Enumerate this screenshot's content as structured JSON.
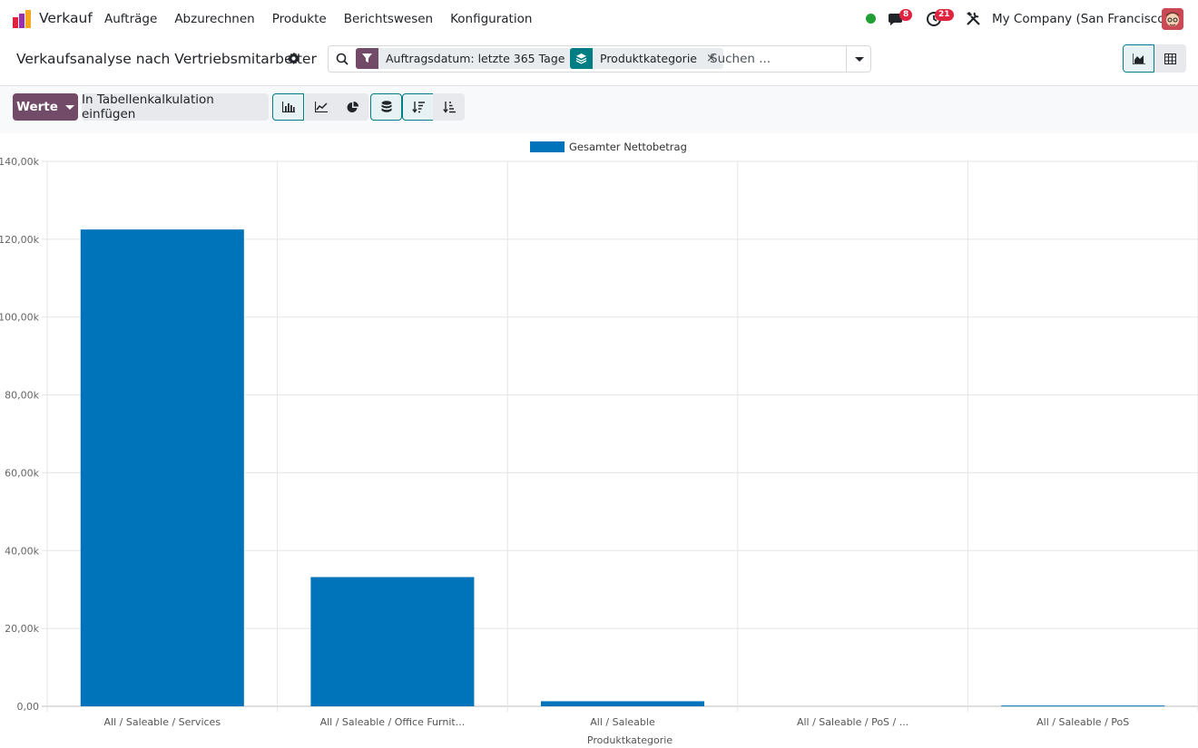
{
  "navbar": {
    "app_name": "Verkauf",
    "menu": [
      "Aufträge",
      "Abzurechnen",
      "Produkte",
      "Berichtswesen",
      "Konfiguration"
    ],
    "messages_count": "8",
    "activities_count": "21",
    "company": "My Company (San Francisco)"
  },
  "control_panel": {
    "title": "Verkaufsanalyse nach Vertriebsmitarbeiter",
    "facets": [
      {
        "type": "filter",
        "label": "Auftragsdatum: letzte 365 Tage",
        "icon": "filter-icon"
      },
      {
        "type": "groupby",
        "label": "Produktkategorie",
        "icon": "layers-icon"
      }
    ],
    "search_placeholder": "Suchen ..."
  },
  "toolbar": {
    "measures_label": "Werte",
    "insert_label": "In Tabellenkalkulation einfügen"
  },
  "colors": {
    "brand": "#714b67",
    "accent": "#017e84",
    "bar": "#0074ba",
    "badge": "#e0243f"
  },
  "chart_data": {
    "type": "bar",
    "categories": [
      "All / Saleable / Services",
      "All / Saleable / Office Furnit...",
      "All / Saleable",
      "All / Saleable / PoS / ...",
      "All / Saleable / PoS"
    ],
    "series": [
      {
        "name": "Gesamter Nettobetrag",
        "values": [
          122500,
          33200,
          1300,
          0,
          200
        ]
      }
    ],
    "xlabel": "Produktkategorie",
    "ylabel": "",
    "ylim": [
      0,
      140000
    ],
    "yticks": [
      "0,00",
      "20,00k",
      "40,00k",
      "60,00k",
      "80,00k",
      "100,00k",
      "120,00k",
      "140,00k"
    ],
    "legend": "top-center",
    "grid": true
  }
}
